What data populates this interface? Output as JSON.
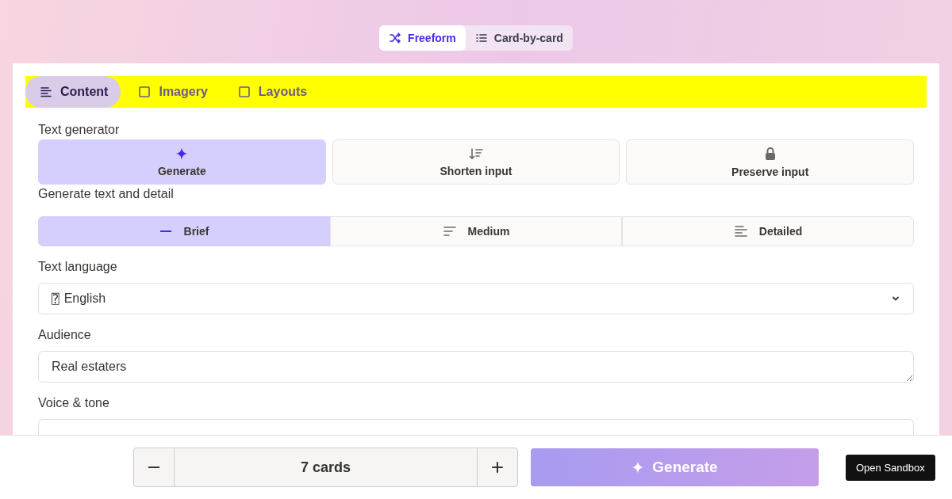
{
  "mode_toggle": [
    {
      "label": "Freeform",
      "selected": true
    },
    {
      "label": "Card-by-card",
      "selected": false
    }
  ],
  "tabs": [
    {
      "label": "Content",
      "selected": true
    },
    {
      "label": "Imagery",
      "selected": false
    },
    {
      "label": "Layouts",
      "selected": false
    }
  ],
  "text_generator": {
    "label": "Text generator",
    "options": [
      {
        "label": "Generate",
        "selected": true
      },
      {
        "label": "Shorten input",
        "selected": false
      },
      {
        "label": "Preserve input",
        "selected": false
      }
    ]
  },
  "detail": {
    "label": "Generate text and detail",
    "options": [
      {
        "label": "Brief",
        "selected": true
      },
      {
        "label": "Medium",
        "selected": false
      },
      {
        "label": "Detailed",
        "selected": false
      }
    ]
  },
  "fields": [
    {
      "kind": "select",
      "label": "Text language",
      "flag": "⍰",
      "value": "English"
    },
    {
      "kind": "textarea",
      "label": "Audience",
      "value": "Real estaters"
    },
    {
      "kind": "textarea",
      "label": "Voice & tone"
    }
  ],
  "footer": {
    "count": "7 cards",
    "generate": "Generate",
    "sandbox": "Open Sandbox"
  }
}
